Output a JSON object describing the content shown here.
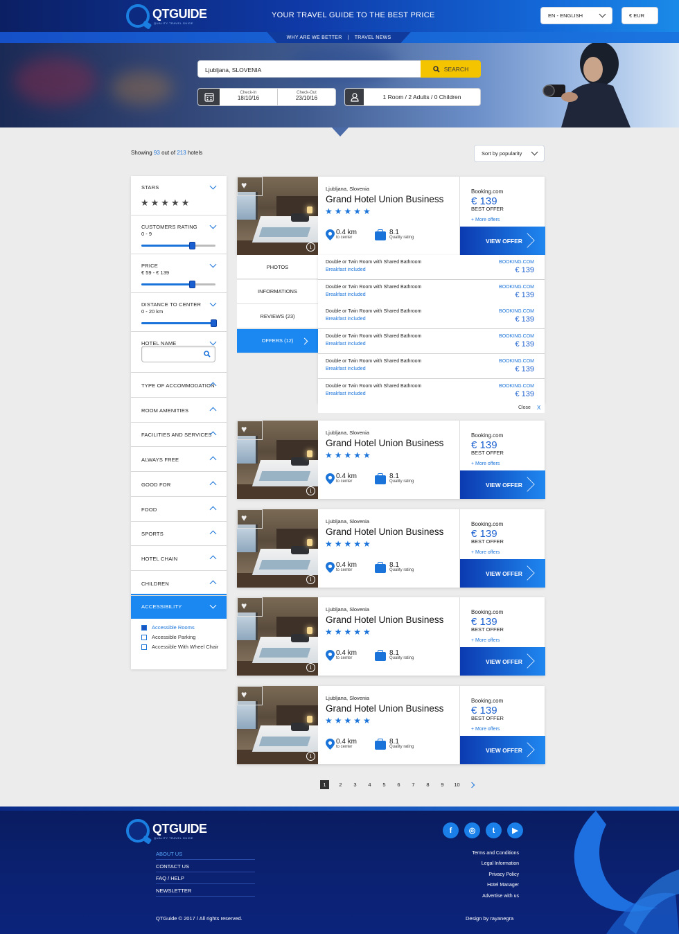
{
  "header": {
    "logo_title": "QTGUIDE",
    "logo_subtitle": "QUALITY TRAVEL GUIDE",
    "tagline": "YOUR TRAVEL GUIDE TO THE BEST PRICE",
    "language": "EN - ENGLISH",
    "currency": "€ EUR"
  },
  "subnav": {
    "link1": "WHY ARE WE BETTER",
    "separator": "|",
    "link2": "TRAVEL NEWS"
  },
  "search": {
    "destination": "Ljubljana, SLOVENIA",
    "button": "SEARCH",
    "checkin_label": "Check-In",
    "checkin_value": "18/10/16",
    "checkout_label": "Check-Out",
    "checkout_value": "23/10/16",
    "guests": "1 Room / 2 Adults / 0 Children"
  },
  "results": {
    "showing_prefix": "Showing",
    "shown_count": "93",
    "out_of": "out of",
    "total_count": "213",
    "suffix": "hotels",
    "sort": "Sort by popularity"
  },
  "filters": {
    "stars": "STARS",
    "stars_glyphs": "★★★★★",
    "customers_rating": "CUSTOMERS RATING",
    "customers_rating_range": "0 - 9",
    "customers_rating_level": 0.68,
    "price": "PRICE",
    "price_range": "€ 59 - € 139",
    "price_level": 0.68,
    "distance": "DISTANCE TO CENTER",
    "distance_range": "0 - 20 km",
    "distance_level": 0.97,
    "hotel_name": "HOTEL NAME",
    "collapsed": [
      "TYPE OF ACCOMMODATION",
      "ROOM AMENITIES",
      "FACILITIES AND SERVICES",
      "ALWAYS FREE",
      "GOOD FOR",
      "FOOD",
      "SPORTS",
      "HOTEL CHAIN",
      "CHILDREN"
    ],
    "accessibility": "ACCESSIBILITY",
    "accessibility_options": [
      {
        "label": "Accessible Rooms",
        "checked": true
      },
      {
        "label": "Accessible Parking",
        "checked": false
      },
      {
        "label": "Accessible With Wheel Chair",
        "checked": false
      }
    ]
  },
  "hotels": [
    {
      "city": "Ljubljana, Slovenia",
      "name": "Grand Hotel Union Business",
      "stars": "★★★★★",
      "distance": "0.4 km",
      "distance_sub": "to center",
      "rating": "8.1",
      "rating_sub": "Quality rating",
      "provider": "Booking.com",
      "price": "€ 139",
      "best": "BEST OFFER",
      "more": "+ More offers",
      "view": "VIEW OFFER"
    },
    {
      "city": "Ljubljana, Slovenia",
      "name": "Grand Hotel Union Business",
      "stars": "★★★★★",
      "distance": "0.4 km",
      "distance_sub": "to center",
      "rating": "8.1",
      "rating_sub": "Quality rating",
      "provider": "Booking.com",
      "price": "€ 139",
      "best": "BEST OFFER",
      "more": "+ More offers",
      "view": "VIEW OFFER"
    },
    {
      "city": "Ljubljana, Slovenia",
      "name": "Grand Hotel Union Business",
      "stars": "★★★★★",
      "distance": "0.4 km",
      "distance_sub": "to center",
      "rating": "8.1",
      "rating_sub": "Quality rating",
      "provider": "Booking.com",
      "price": "€ 139",
      "best": "BEST OFFER",
      "more": "+ More offers",
      "view": "VIEW OFFER"
    },
    {
      "city": "Ljubljana, Slovenia",
      "name": "Grand Hotel Union Business",
      "stars": "★★★★★",
      "distance": "0.4 km",
      "distance_sub": "to center",
      "rating": "8.1",
      "rating_sub": "Quality rating",
      "provider": "Booking.com",
      "price": "€ 139",
      "best": "BEST OFFER",
      "more": "+ More offers",
      "view": "VIEW OFFER"
    },
    {
      "city": "Ljubljana, Slovenia",
      "name": "Grand Hotel Union Business",
      "stars": "★★★★★",
      "distance": "0.4 km",
      "distance_sub": "to center",
      "rating": "8.1",
      "rating_sub": "Quality rating",
      "provider": "Booking.com",
      "price": "€ 139",
      "best": "BEST OFFER",
      "more": "+ More offers",
      "view": "VIEW OFFER"
    }
  ],
  "tabs": [
    "PHOTOS",
    "INFORMATIONS",
    "REVIEWS (23)",
    "OFFERS (12)"
  ],
  "offers": [
    {
      "room": "Double or Twin Room with Shared Bathroom",
      "extra": "Breakfast included",
      "provider": "BOOKING.COM",
      "price": "€ 139"
    },
    {
      "room": "Double or Twin Room with Shared Bathroom",
      "extra": "Breakfast included",
      "provider": "BOOKING.COM",
      "price": "€ 139"
    },
    {
      "room": "Double or Twin Room with Shared Bathroom",
      "extra": "Breakfast included",
      "provider": "BOOKING.COM",
      "price": "€ 139"
    },
    {
      "room": "Double or Twin Room with Shared Bathroom",
      "extra": "Breakfast included",
      "provider": "BOOKING.COM",
      "price": "€ 139"
    },
    {
      "room": "Double or Twin Room with Shared Bathroom",
      "extra": "Breakfast included",
      "provider": "BOOKING.COM",
      "price": "€ 139"
    },
    {
      "room": "Double or Twin Room with Shared Bathroom",
      "extra": "Breakfast included",
      "provider": "BOOKING.COM",
      "price": "€ 139"
    }
  ],
  "offers_close": "Close",
  "offers_close_x": "X",
  "pagination": [
    "1",
    "2",
    "3",
    "4",
    "5",
    "6",
    "7",
    "8",
    "9",
    "10"
  ],
  "footer": {
    "links": [
      "ABOUT US",
      "CONTACT US",
      "FAQ / HELP",
      "NEWSLETTER"
    ],
    "social": [
      "f",
      "◎",
      "t",
      "▶"
    ],
    "right_links": [
      "Terms and Conditions",
      "Legal Information",
      "Privacy Policy",
      "Hotel Manager",
      "Advertise with us"
    ],
    "copyright": "QTGuide © 2017 / All rights reserved.",
    "design": "Design by rayanegra"
  },
  "colors": {
    "accent": "#1a73d9",
    "search": "#f5c400",
    "footer": "#0b2273"
  }
}
